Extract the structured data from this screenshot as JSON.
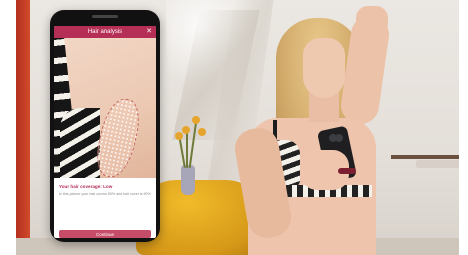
{
  "app": {
    "header_title": "Hair analysis",
    "close_label": "✕",
    "result_title": "Your hair coverage: Low",
    "result_text": "In this picture your hair covers 60% and hair cover is 90%",
    "continue_label": "Continue"
  },
  "colors": {
    "accent": "#b52e56",
    "button": "#c64d69",
    "highlight_outline": "#c2685d"
  },
  "icons": {
    "close": "close-icon"
  }
}
